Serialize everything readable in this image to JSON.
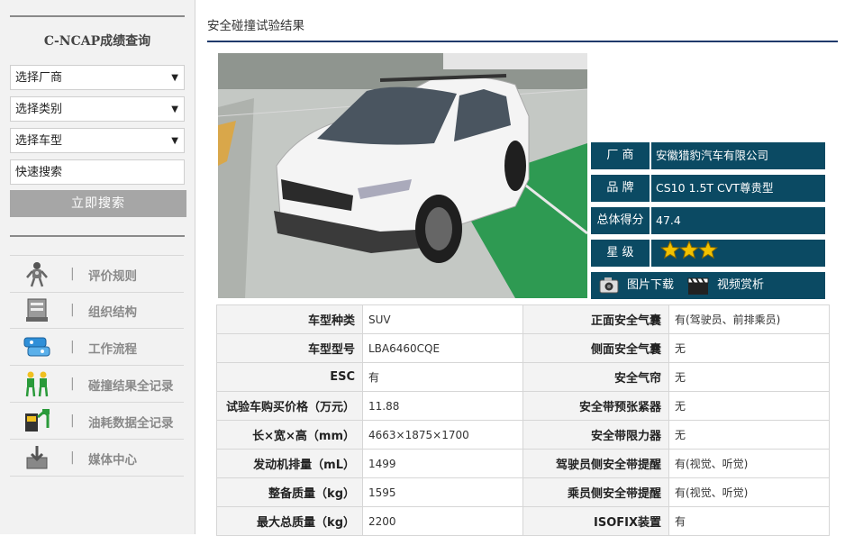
{
  "sidebar": {
    "title": "C-NCAP成绩查询",
    "selects": [
      {
        "value": "选择厂商"
      },
      {
        "value": "选择类别"
      },
      {
        "value": "选择车型"
      }
    ],
    "search_input": {
      "value": "快速搜索"
    },
    "search_button": "立即搜索",
    "separator": "|",
    "menu": [
      {
        "label": "评价规则",
        "icon": "crash-dummy-icon"
      },
      {
        "label": "组织结构",
        "icon": "organization-icon"
      },
      {
        "label": "工作流程",
        "icon": "workflow-icon"
      },
      {
        "label": "碰撞结果全记录",
        "icon": "seated-dummies-icon"
      },
      {
        "label": "油耗数据全记录",
        "icon": "fuel-pump-icon"
      },
      {
        "label": "媒体中心",
        "icon": "media-download-icon"
      }
    ]
  },
  "main": {
    "section_title": "安全碰撞试验结果",
    "info": [
      {
        "label": "厂  商",
        "value": "安徽猎豹汽车有限公司"
      },
      {
        "label": "品  牌",
        "value": "CS10 1.5T CVT尊贵型"
      },
      {
        "label": "总体得分",
        "value": "47.4"
      },
      {
        "label": "星  级",
        "stars": 3
      }
    ],
    "downloads": {
      "photo_label": "图片下载",
      "video_label": "视频赏析"
    },
    "specs": [
      {
        "k1": "车型种类",
        "v1": "SUV",
        "k2": "正面安全气囊",
        "v2": "有(驾驶员、前排乘员)"
      },
      {
        "k1": "车型型号",
        "v1": "LBA6460CQE",
        "k2": "侧面安全气囊",
        "v2": "无"
      },
      {
        "k1": "ESC",
        "v1": "有",
        "k2": "安全气帘",
        "v2": "无"
      },
      {
        "k1": "试验车购买价格（万元）",
        "v1": "11.88",
        "k2": "安全带预张紧器",
        "v2": "无"
      },
      {
        "k1": "长×宽×高（mm）",
        "v1": "4663×1875×1700",
        "k2": "安全带限力器",
        "v2": "无"
      },
      {
        "k1": "发动机排量（mL）",
        "v1": "1499",
        "k2": "驾驶员侧安全带提醒",
        "v2": "有(视觉、听觉)"
      },
      {
        "k1": "整备质量（kg）",
        "v1": "1595",
        "k2": "乘员侧安全带提醒",
        "v2": "有(视觉、听觉)"
      },
      {
        "k1": "最大总质量（kg）",
        "v1": "2200",
        "k2": "ISOFIX装置",
        "v2": "有"
      }
    ]
  },
  "colors": {
    "accent_dark_teal": "#0b4a63",
    "rule_navy": "#1f3a6b",
    "star_gold": "#f2c200",
    "button_gray": "#a6a6a6"
  }
}
